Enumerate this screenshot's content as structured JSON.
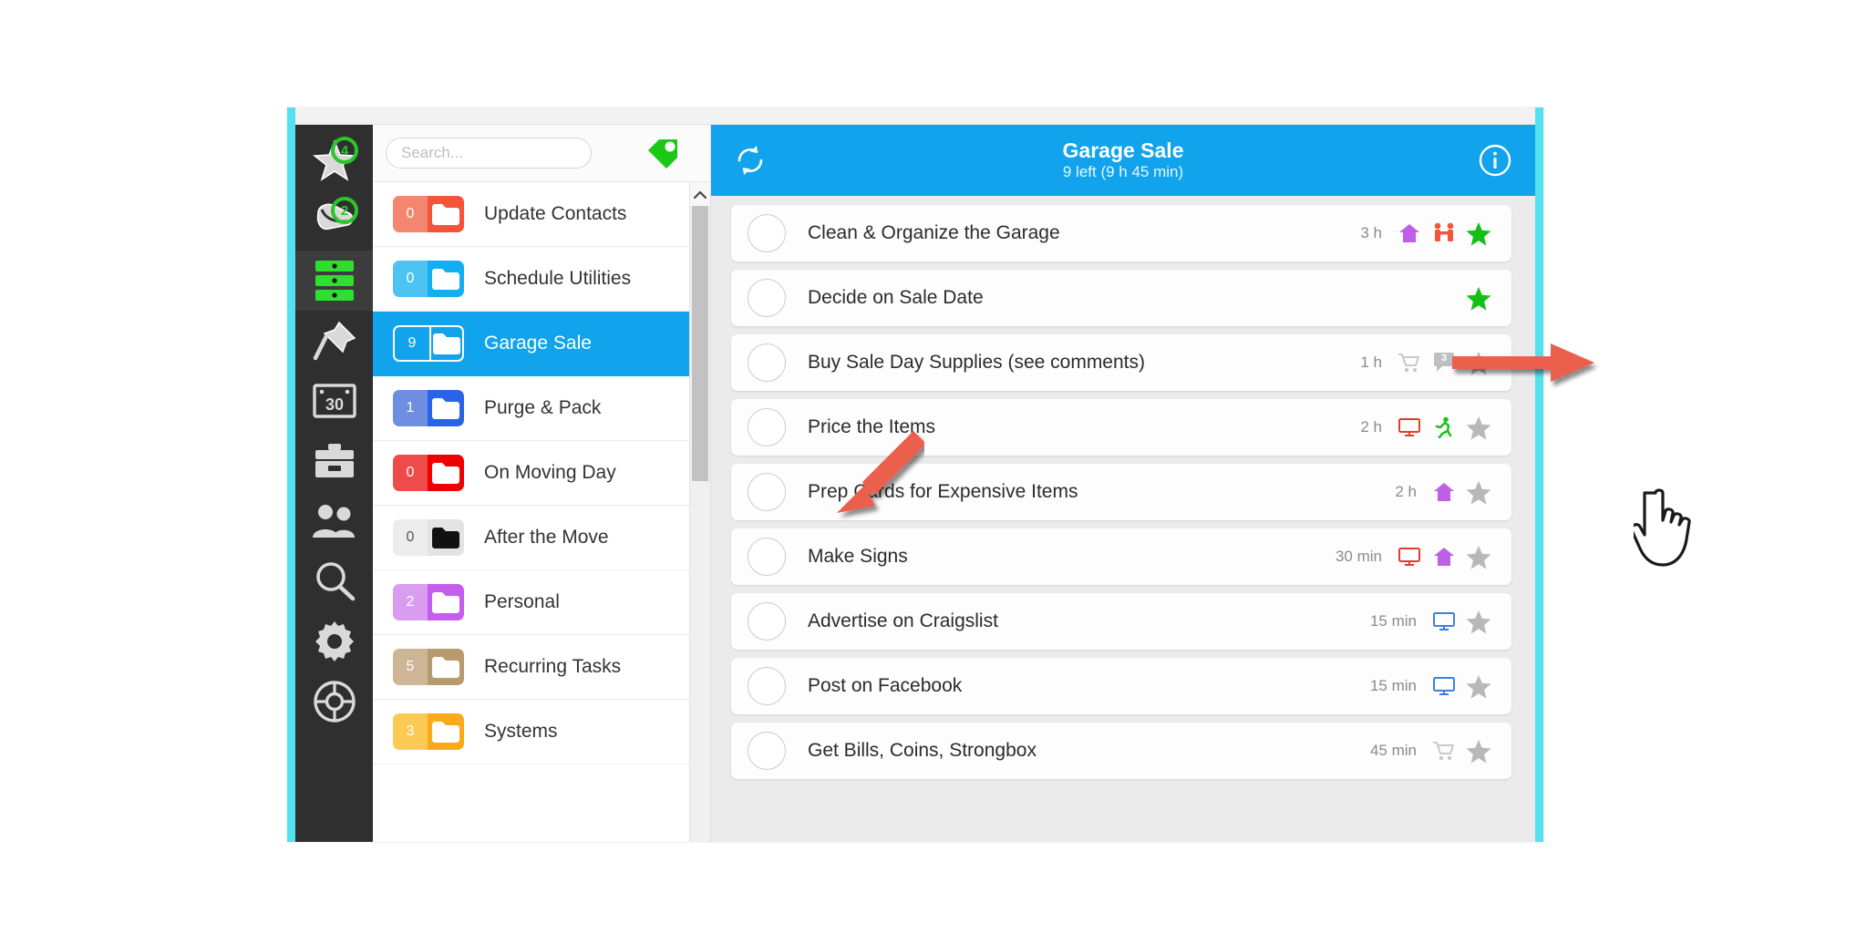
{
  "window": {
    "frame_color": "#54e0ef",
    "accent_color": "#11a3ec"
  },
  "icon_rail": {
    "items": [
      {
        "name": "star-icon",
        "label": "Starred",
        "badge": "4",
        "active": false
      },
      {
        "name": "hand-icon",
        "label": "Next Actions",
        "badge": "2",
        "active": false
      },
      {
        "name": "stack-list-icon",
        "label": "Lists",
        "badge": "",
        "active": true
      },
      {
        "name": "pushpin-icon",
        "label": "Pinned",
        "badge": "",
        "active": false
      },
      {
        "name": "calendar-icon",
        "label": "Calendar",
        "badge": "30",
        "active": false
      },
      {
        "name": "toolbox-icon",
        "label": "Tools",
        "badge": "",
        "active": false
      },
      {
        "name": "people-icon",
        "label": "Contacts",
        "badge": "",
        "active": false
      },
      {
        "name": "magnifier-icon",
        "label": "Search",
        "badge": "",
        "active": false
      },
      {
        "name": "gear-icon",
        "label": "Settings",
        "badge": "",
        "active": false
      },
      {
        "name": "lifebuoy-icon",
        "label": "Help",
        "badge": "",
        "active": false
      }
    ]
  },
  "search": {
    "placeholder": "Search...",
    "value": "",
    "tag_icon_color": "#1cc816"
  },
  "folders": [
    {
      "count": "0",
      "label": "Update Contacts",
      "color_light": "#f4856f",
      "color_dark": "#f4543a",
      "folder_white": true,
      "selected": false
    },
    {
      "count": "0",
      "label": "Schedule Utilities",
      "color_light": "#4cc3f2",
      "color_dark": "#13aef0",
      "folder_white": true,
      "selected": false
    },
    {
      "count": "9",
      "label": "Garage Sale",
      "color_light": "#11a3ec",
      "color_dark": "#11a3ec",
      "folder_white": true,
      "selected": true
    },
    {
      "count": "1",
      "label": "Purge & Pack",
      "color_light": "#6f8ee0",
      "color_dark": "#2b63e8",
      "folder_white": true,
      "selected": false
    },
    {
      "count": "0",
      "label": "On Moving Day",
      "color_light": "#ef4b4b",
      "color_dark": "#ee0000",
      "folder_white": true,
      "selected": false
    },
    {
      "count": "0",
      "label": "After the Move",
      "color_light": "#ececec",
      "color_dark": "#e3e3e3",
      "folder_white": false,
      "selected": false
    },
    {
      "count": "2",
      "label": "Personal",
      "color_light": "#d99cf0",
      "color_dark": "#c55ded",
      "folder_white": true,
      "selected": false
    },
    {
      "count": "5",
      "label": "Recurring Tasks",
      "color_light": "#ceb595",
      "color_dark": "#b89a6f",
      "folder_white": true,
      "selected": false
    },
    {
      "count": "3",
      "label": "Systems",
      "color_light": "#fcc954",
      "color_dark": "#fbaa18",
      "folder_white": true,
      "selected": false
    }
  ],
  "task_header": {
    "refresh_icon": "refresh-icon",
    "title": "Garage Sale",
    "subtitle": "9 left (9 h 45 min)",
    "info_icon": "info-icon"
  },
  "tasks": [
    {
      "title": "Clean & Organize the Garage",
      "duration": "3 h",
      "icons": [
        "house-icon",
        "people-pair-icon"
      ],
      "star": "green"
    },
    {
      "title": "Decide on Sale Date",
      "duration": "",
      "icons": [],
      "star": "green"
    },
    {
      "title": "Buy Sale Day Supplies (see comments)",
      "duration": "1 h",
      "icons": [
        "cart-icon",
        "comment-icon"
      ],
      "star": "gray",
      "comment_count": "3"
    },
    {
      "title": "Price the Items",
      "duration": "2 h",
      "icons": [
        "monitor-red-icon",
        "runner-icon"
      ],
      "star": "gray"
    },
    {
      "title": "Prep Cards for Expensive Items",
      "duration": "2 h",
      "icons": [
        "house-icon"
      ],
      "star": "gray"
    },
    {
      "title": "Make Signs",
      "duration": "30 min",
      "icons": [
        "monitor-red-icon",
        "house-icon"
      ],
      "star": "gray"
    },
    {
      "title": "Advertise on Craigslist",
      "duration": "15 min",
      "icons": [
        "monitor-blue-icon"
      ],
      "star": "gray"
    },
    {
      "title": "Post on Facebook",
      "duration": "15 min",
      "icons": [
        "monitor-blue-icon"
      ],
      "star": "gray"
    },
    {
      "title": "Get Bills, Coins, Strongbox",
      "duration": "45 min",
      "icons": [
        "cart-icon"
      ],
      "star": "gray"
    }
  ],
  "annotations": {
    "arrow_color": "#eb5f4e",
    "folder_arrow_target": "Garage Sale",
    "task_arrow_target": "Clean & Organize the Garage",
    "cursor": "pointer-hand-cursor"
  }
}
